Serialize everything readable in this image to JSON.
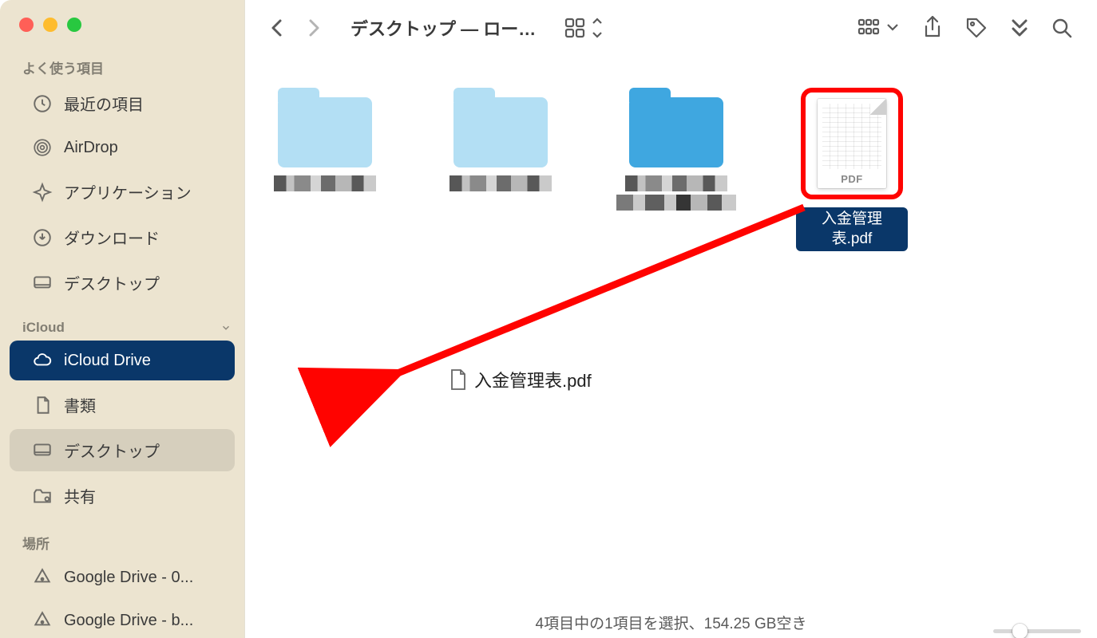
{
  "toolbar": {
    "title": "デスクトップ — ロー…"
  },
  "sidebar": {
    "favorites_header": "よく使う項目",
    "icloud_header": "iCloud",
    "locations_header": "場所",
    "favorites": [
      {
        "icon": "clock",
        "label": "最近の項目"
      },
      {
        "icon": "airdrop",
        "label": "AirDrop"
      },
      {
        "icon": "apps",
        "label": "アプリケーション"
      },
      {
        "icon": "download",
        "label": "ダウンロード"
      },
      {
        "icon": "desktop",
        "label": "デスクトップ"
      }
    ],
    "icloud": [
      {
        "icon": "cloud",
        "label": "iCloud Drive",
        "drop_target": true
      },
      {
        "icon": "doc",
        "label": "書類"
      },
      {
        "icon": "desktop",
        "label": "デスクトップ",
        "current": true
      },
      {
        "icon": "shared",
        "label": "共有"
      }
    ],
    "locations": [
      {
        "icon": "gdrive",
        "label": "Google Drive - 0..."
      },
      {
        "icon": "gdrive",
        "label": "Google Drive - b..."
      }
    ]
  },
  "content": {
    "pdf_badge": "PDF",
    "selected_file_name": "入金管理表.pdf"
  },
  "drag_ghost": {
    "filename": "入金管理表.pdf"
  },
  "status_text": "4項目中の1項目を選択、154.25 GB空き"
}
